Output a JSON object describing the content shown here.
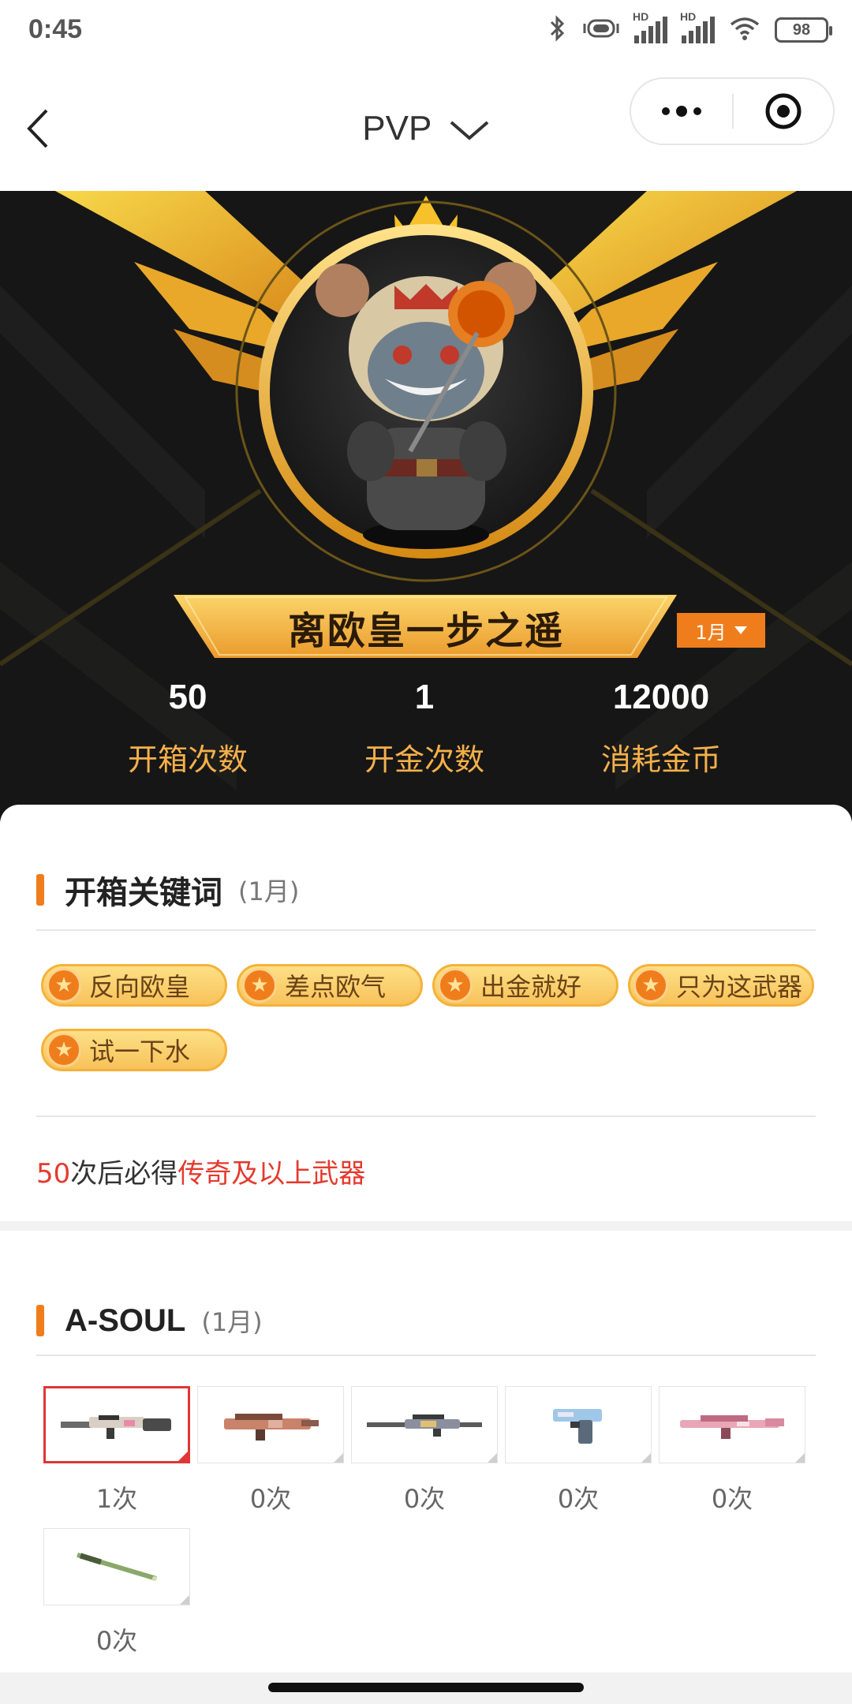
{
  "status_bar": {
    "time": "0:45",
    "battery": "98",
    "hd1": "HD",
    "hd2": "HD"
  },
  "nav": {
    "title": "PVP"
  },
  "hero": {
    "rank_title": "离欧皇一步之遥",
    "month": "1月",
    "stats": [
      {
        "value": "50",
        "label": "开箱次数"
      },
      {
        "value": "1",
        "label": "开金次数"
      },
      {
        "value": "12000",
        "label": "消耗金币"
      }
    ]
  },
  "keywords": {
    "title": "开箱关键词",
    "subtitle": "(1月)",
    "tags": [
      "反向欧皇",
      "差点欧气",
      "出金就好",
      "只为这武器",
      "试一下水"
    ],
    "guarantee": {
      "count": "50",
      "middle": "次后必得",
      "reward": "传奇及以上武器"
    }
  },
  "asoul": {
    "title": "A-SOUL",
    "subtitle": "(1月)",
    "weapons": [
      {
        "count": "1次",
        "icon": "rifle-icon"
      },
      {
        "count": "0次",
        "icon": "assault-rifle-icon"
      },
      {
        "count": "0次",
        "icon": "sniper-rifle-icon"
      },
      {
        "count": "0次",
        "icon": "pistol-icon"
      },
      {
        "count": "0次",
        "icon": "assault-rifle-pink-icon"
      },
      {
        "count": "0次",
        "icon": "melee-stick-icon"
      }
    ]
  },
  "colors": {
    "accent": "#f07d1c",
    "gold": "#f5b04a",
    "red": "#e43a2e"
  }
}
